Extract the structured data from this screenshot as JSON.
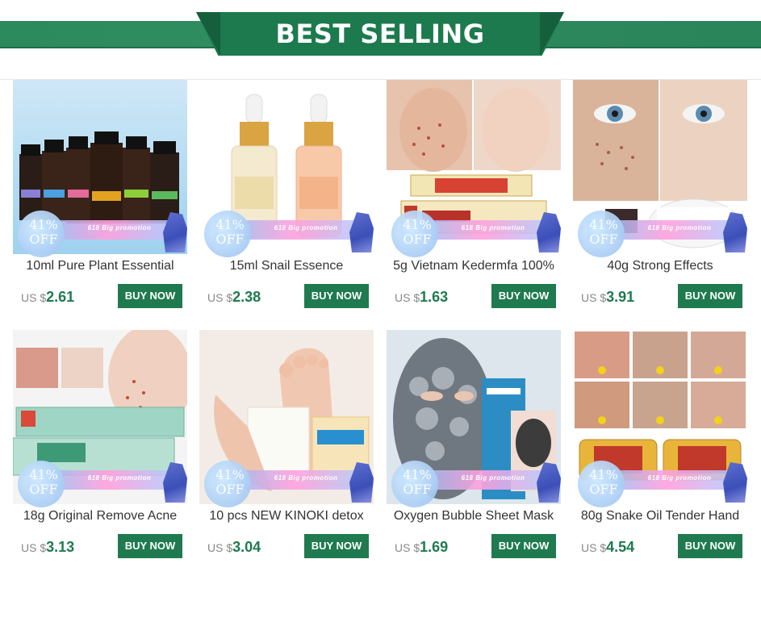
{
  "banner": {
    "title": "BEST SELLING"
  },
  "promo": {
    "percent": "41%",
    "off": "OFF",
    "text": "618 Big promotion"
  },
  "colors": {
    "brand_green": "#1f7a4f",
    "banner_green": "#2d8a5c"
  },
  "products": [
    {
      "name": "10ml Pure Plant Essential",
      "currency": "US $",
      "price": "2.61",
      "button": "BUY NOW",
      "image": "essential-oil-bottles"
    },
    {
      "name": "15ml Snail Essence",
      "currency": "US $",
      "price": "2.38",
      "button": "BUY NOW",
      "image": "serum-dropper-bottles"
    },
    {
      "name": "5g Vietnam Kedermfa 100%",
      "currency": "US $",
      "price": "1.63",
      "button": "BUY NOW",
      "image": "kedermfa-cream-face"
    },
    {
      "name": "40g Strong Effects",
      "currency": "US $",
      "price": "3.91",
      "button": "BUY NOW",
      "image": "freckle-cream-eyes"
    },
    {
      "name": "18g Original Remove Acne",
      "currency": "US $",
      "price": "3.13",
      "button": "BUY NOW",
      "image": "acne-cream-face"
    },
    {
      "name": "10 pcs NEW KINOKI detox",
      "currency": "US $",
      "price": "3.04",
      "button": "BUY NOW",
      "image": "detox-foot-pad"
    },
    {
      "name": "Oxygen Bubble Sheet Mask",
      "currency": "US $",
      "price": "1.69",
      "button": "BUY NOW",
      "image": "bubble-mask-face"
    },
    {
      "name": "80g Snake Oil Tender Hand",
      "currency": "US $",
      "price": "4.54",
      "button": "BUY NOW",
      "image": "snake-oil-hand-cream"
    }
  ]
}
